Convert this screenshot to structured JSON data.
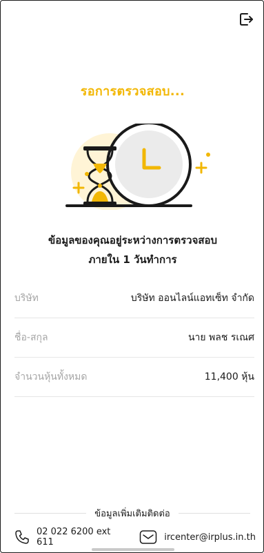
{
  "header": {
    "logout_icon": "logout-icon"
  },
  "status": {
    "title": "รอการตรวจสอบ...",
    "message_line1": "ข้อมูลของคุณอยู่ระหว่างการตรวจสอบ",
    "message_line2": "ภายใน 1 วันทำการ",
    "illustration": "hourglass-clock-illustration"
  },
  "info_rows": [
    {
      "label": "บริษัท",
      "value": "บริษัท ออนไลน์แอทเซ็ท จำกัด"
    },
    {
      "label": "ชื่อ-สกุล",
      "value": "นาย พลช รเณศ"
    },
    {
      "label": "จำนวนหุ้นทั้งหมด",
      "value": "11,400 หุ้น"
    }
  ],
  "contact": {
    "section_title": "ข้อมูลเพิ่มเติมติดต่อ",
    "phone": "02 022 6200 ext 611",
    "email": "ircenter@irplus.in.th",
    "phone_icon": "phone-icon",
    "email_icon": "mail-icon"
  },
  "colors": {
    "accent": "#f2b705",
    "accent_light": "#fff4d6",
    "text": "#1a1a1a",
    "muted": "#a6a6a6"
  }
}
